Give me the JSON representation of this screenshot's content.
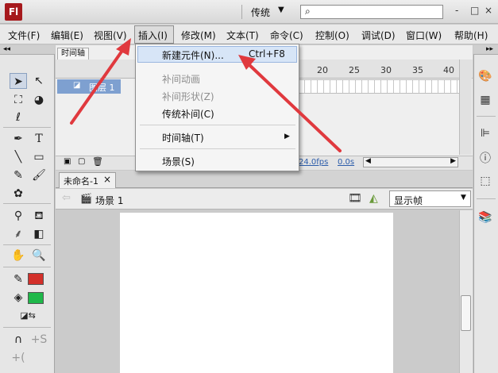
{
  "app": {
    "logo_text": "Fl",
    "workspace_mode": "传统",
    "search_placeholder": "",
    "window_buttons": [
      "-",
      "□",
      "×"
    ]
  },
  "menubar": {
    "items": [
      "文件(F)",
      "编辑(E)",
      "视图(V)",
      "插入(I)",
      "修改(M)",
      "文本(T)",
      "命令(C)",
      "控制(O)",
      "调试(D)",
      "窗口(W)",
      "帮助(H)"
    ],
    "active_item": "插入(I)"
  },
  "insert_menu": {
    "items": [
      {
        "label": "新建元件(N)...",
        "shortcut": "Ctrl+F8",
        "enabled": true,
        "highlighted": true
      },
      {
        "label": "补间动画",
        "enabled": false
      },
      {
        "label": "补间形状(Z)",
        "enabled": false
      },
      {
        "label": "传统补间(C)",
        "enabled": true
      },
      {
        "label": "时间轴(T)",
        "enabled": true,
        "submenu": true
      },
      {
        "label": "场景(S)",
        "enabled": true
      }
    ]
  },
  "timeline": {
    "tab_label": "时间轴",
    "layer_name": "图层 1",
    "frame_numbers": [
      "20",
      "25",
      "30",
      "35",
      "40"
    ],
    "fps": "24.0fps",
    "seconds": "0.0s"
  },
  "document": {
    "tab_title": "未命名-1",
    "close_glyph": "×",
    "scene_label": "场景 1",
    "zoom_value": "显示帧"
  },
  "colors": {
    "stroke_color": "#d3302a",
    "fill_color": "#1fb84a",
    "arrow_color": "#e0393e",
    "selection_blue": "#7ea0d0"
  },
  "icons": {
    "tools": [
      "selection-arrow-icon",
      "subselection-icon",
      "free-transform-icon",
      "3d-rotation-icon",
      "lasso-icon",
      "pen-icon",
      "text-icon",
      "line-icon",
      "rectangle-icon",
      "pencil-icon",
      "brush-icon",
      "deco-icon",
      "bone-icon",
      "paint-bucket-icon",
      "eyedropper-icon",
      "eraser-icon",
      "hand-icon",
      "zoom-icon",
      "stroke-color-icon",
      "fill-color-icon",
      "swap-colors-icon",
      "snap-magnet-icon",
      "smooth-icon",
      "straighten-icon"
    ],
    "right_panel": [
      "color-palette-icon",
      "swatches-grid-icon",
      "align-icon",
      "info-icon",
      "transform-icon",
      "library-icon"
    ]
  }
}
